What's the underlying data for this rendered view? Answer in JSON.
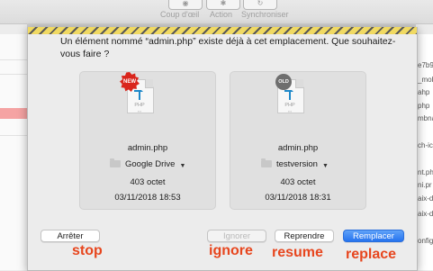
{
  "toolbar": {
    "items": [
      "Coup d'œil",
      "Action",
      "Synchroniser"
    ]
  },
  "background_right_items": [
    "e7b9",
    "_mob",
    "ahp",
    "php",
    "mbna",
    "ch-ic",
    "nt.ph",
    "ni.pr",
    "aix-d",
    "aix-d",
    "onfig"
  ],
  "dialog": {
    "message": "Un élément nommé “admin.php” existe déjà à cet emplacement. Que souhaitez-vous faire ?",
    "new_file": {
      "badge": "NEW",
      "icon_text": "PHP",
      "name": "admin.php",
      "location": "Google Drive",
      "size": "403 octet",
      "date": "03/11/2018 18:53"
    },
    "old_file": {
      "badge": "OLD",
      "icon_text": "PHP",
      "name": "admin.php",
      "location": "testversion",
      "size": "403 octet",
      "date": "03/11/2018 18:31"
    },
    "buttons": {
      "stop": "Arrêter",
      "ignore": "Ignorer",
      "resume": "Reprendre",
      "replace": "Remplacer"
    }
  },
  "annotations": {
    "stop": "stop",
    "ignore": "ignore",
    "resume": "resume",
    "replace": "replace"
  },
  "colors": {
    "annotation": "#e7461e",
    "primary_button": "#2673ef",
    "new_badge": "#d9251c",
    "old_badge": "#6e6e6e",
    "warning_stripe": "#f1d64a"
  }
}
